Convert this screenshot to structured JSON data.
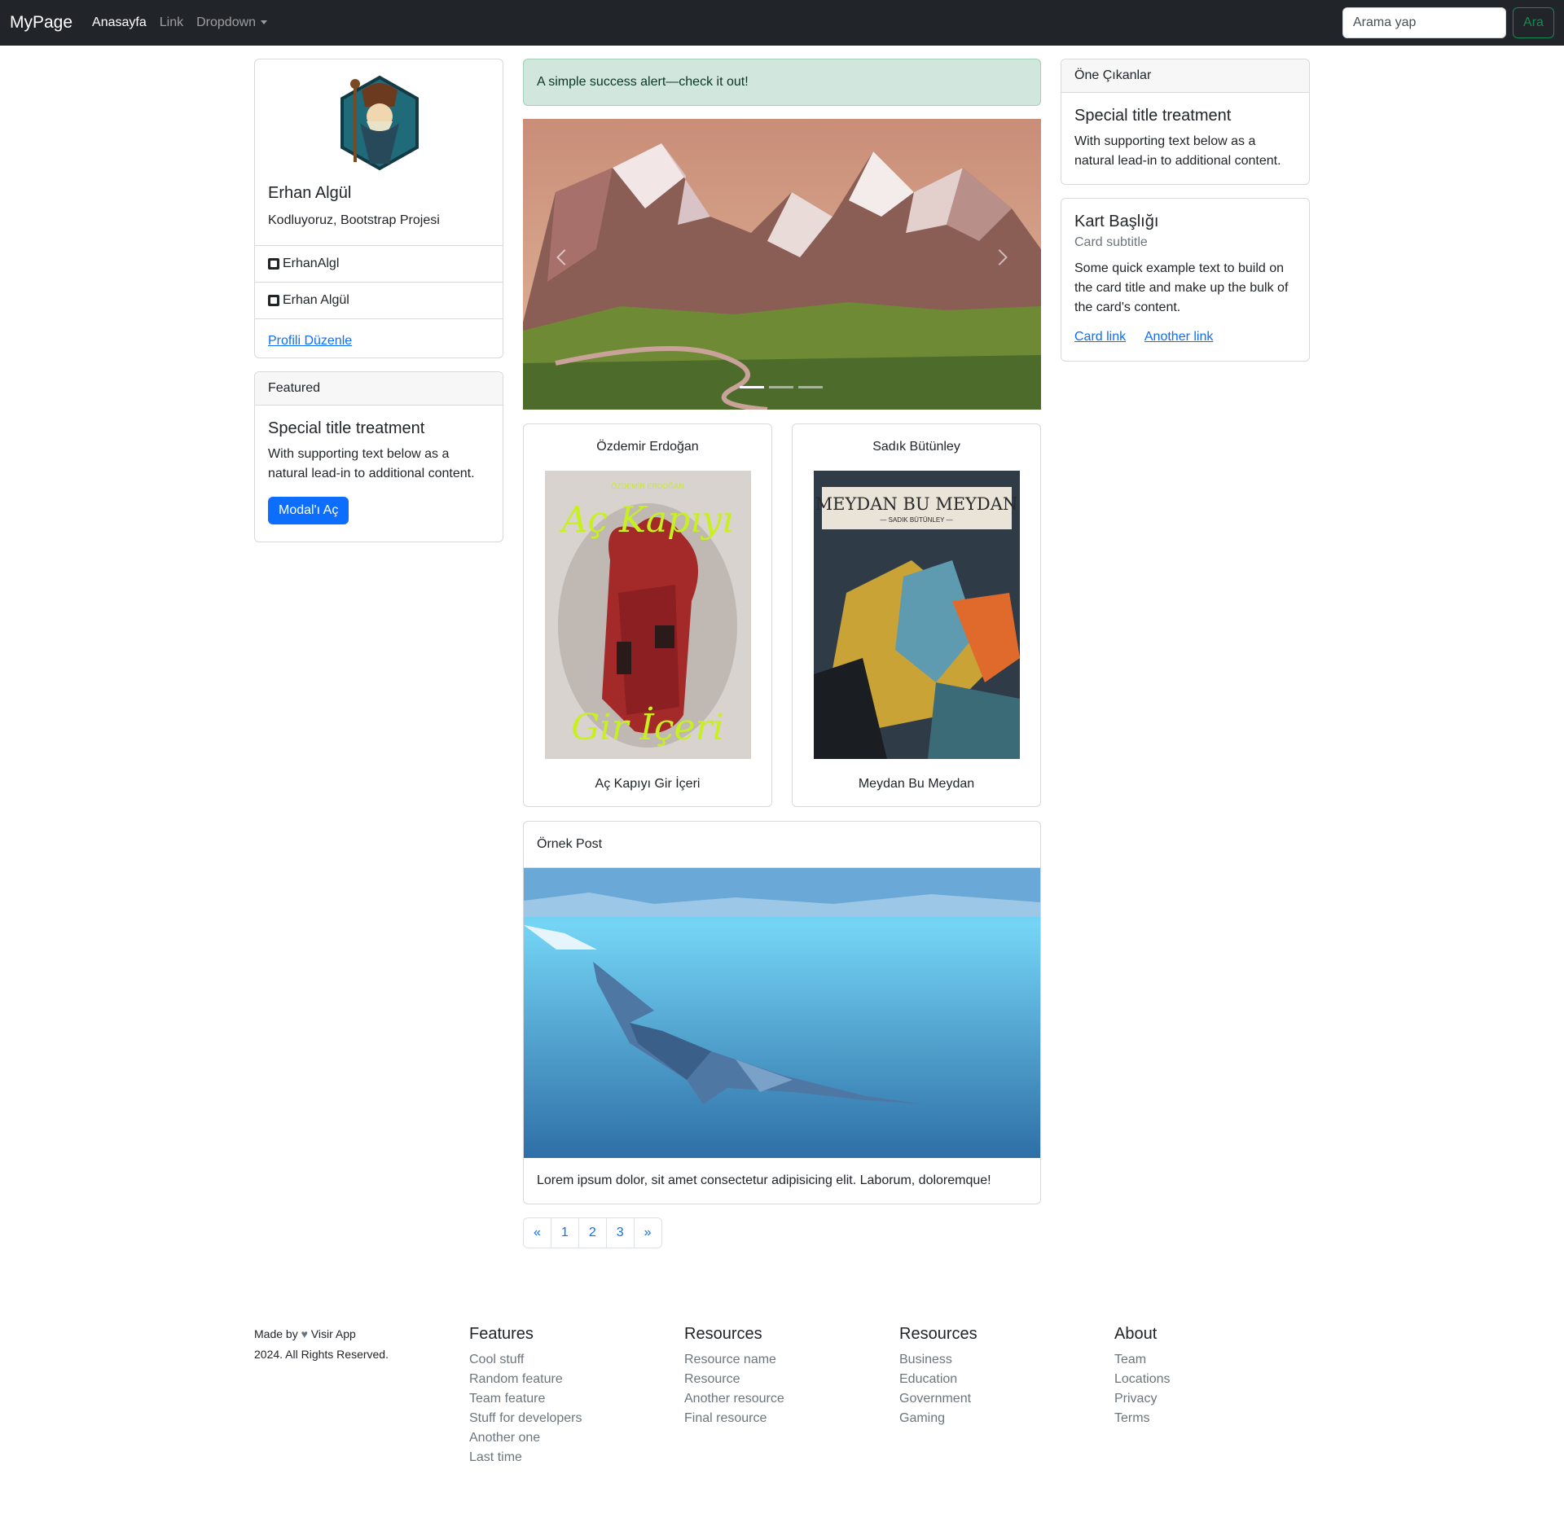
{
  "navbar": {
    "brand": "MyPage",
    "links": [
      "Anasayfa",
      "Link",
      "Dropdown"
    ],
    "search_placeholder": "Arama yap",
    "search_button": "Ara"
  },
  "profile": {
    "name": "Erhan Algül",
    "subtitle": "Kodluyoruz, Bootstrap Projesi",
    "linkedin": "ErhanAlgl",
    "github": "Erhan Algül",
    "edit_link": "Profili Düzenle"
  },
  "featured": {
    "header": "Featured",
    "title": "Special title treatment",
    "text": "With supporting text below as a natural lead-in to additional content.",
    "button": "Modal'ı Aç"
  },
  "alert": {
    "text": "A simple success alert—check it out!"
  },
  "books": [
    {
      "author": "Özdemir Erdoğan",
      "title": "Aç Kapıyı Gir İçeri",
      "cover_top": "ÖZDEMİR ERDOĞAN",
      "cover_line1": "Aç Kapıyı",
      "cover_line2": "Gir İçeri"
    },
    {
      "author": "Sadık Bütünley",
      "title": "Meydan Bu Meydan",
      "cover_top": "MEYDAN BU MEYDAN",
      "cover_line1": "— SADIK BÜTÜNLEY —"
    }
  ],
  "post": {
    "header": "Örnek Post",
    "text": "Lorem ipsum dolor, sit amet consectetur adipisicing elit. Laborum, doloremque!"
  },
  "pagination": [
    "«",
    "1",
    "2",
    "3",
    "»"
  ],
  "highlights": {
    "header": "Öne Çıkanlar",
    "title": "Special title treatment",
    "text": "With supporting text below as a natural lead-in to additional content."
  },
  "info_card": {
    "title": "Kart Başlığı",
    "subtitle": "Card subtitle",
    "text": "Some quick example text to build on the card title and make up the bulk of the card's content.",
    "link1": "Card link",
    "link2": "Another link"
  },
  "footer": {
    "made_by_prefix": "Made by",
    "made_by_suffix": "Visir App",
    "rights": "2024. All Rights Reserved.",
    "columns": [
      {
        "title": "Features",
        "items": [
          "Cool stuff",
          "Random feature",
          "Team feature",
          "Stuff for developers",
          "Another one",
          "Last time"
        ]
      },
      {
        "title": "Resources",
        "items": [
          "Resource name",
          "Resource",
          "Another resource",
          "Final resource"
        ]
      },
      {
        "title": "Resources",
        "items": [
          "Business",
          "Education",
          "Government",
          "Gaming"
        ]
      },
      {
        "title": "About",
        "items": [
          "Team",
          "Locations",
          "Privacy",
          "Terms"
        ]
      }
    ]
  },
  "colors": {
    "navbar": "#212529",
    "primary": "#0d6efd",
    "success": "#198754",
    "alert_bg": "#d1e7dd"
  }
}
